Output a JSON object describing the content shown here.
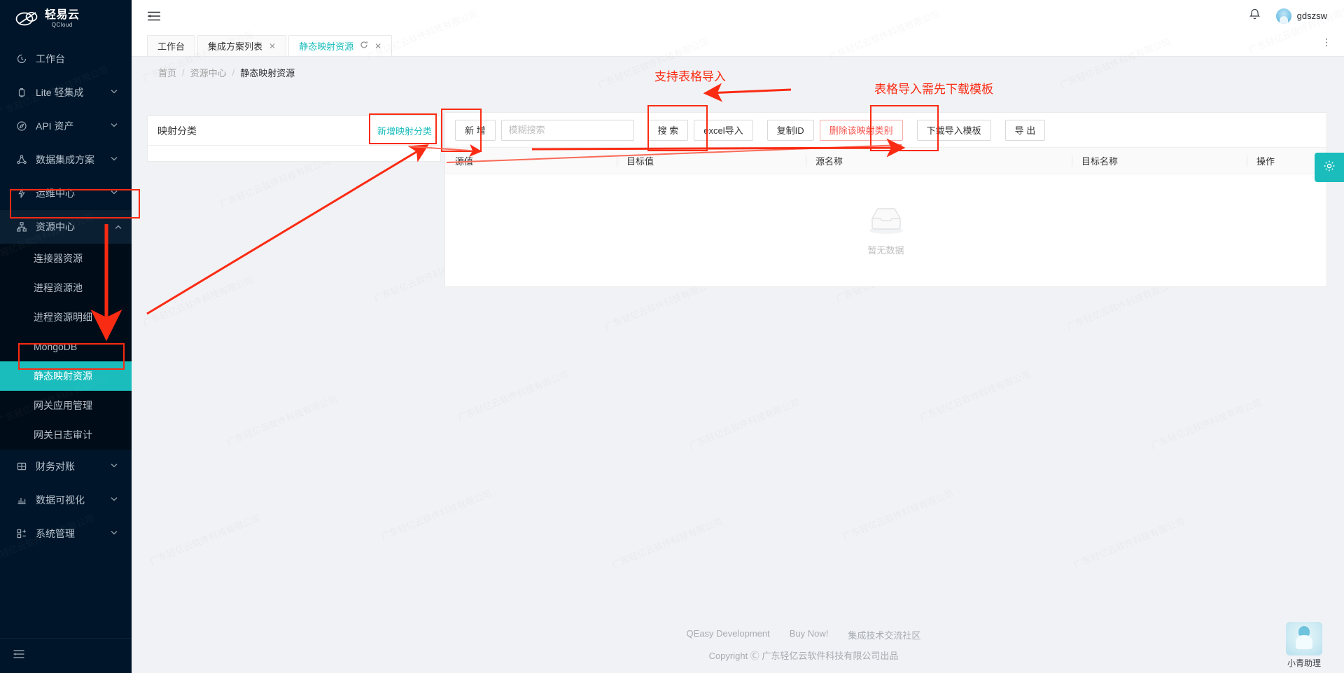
{
  "brand": {
    "name_cn": "轻易云",
    "name_en": "QCloud",
    "logo_icon": "cloud-logo-icon"
  },
  "sidebar": {
    "collapse_icon": "menu-collapse-icon",
    "items": [
      {
        "label": "工作台",
        "icon": "dashboard-icon",
        "expandable": false
      },
      {
        "label": "Lite 轻集成",
        "icon": "lite-integration-icon",
        "expandable": true
      },
      {
        "label": "API 资产",
        "icon": "api-asset-icon",
        "expandable": true
      },
      {
        "label": "数据集成方案",
        "icon": "data-integration-icon",
        "expandable": true
      },
      {
        "label": "运维中心",
        "icon": "ops-center-icon",
        "expandable": true
      },
      {
        "label": "资源中心",
        "icon": "resource-center-icon",
        "expandable": true,
        "expanded": true,
        "active": true
      },
      {
        "label": "财务对账",
        "icon": "finance-icon",
        "expandable": true
      },
      {
        "label": "数据可视化",
        "icon": "visualization-icon",
        "expandable": true
      },
      {
        "label": "系统管理",
        "icon": "system-settings-icon",
        "expandable": true
      }
    ],
    "submenu": [
      {
        "label": "连接器资源",
        "selected": false
      },
      {
        "label": "进程资源池",
        "selected": false
      },
      {
        "label": "进程资源明细",
        "selected": false
      },
      {
        "label": "MongoDB",
        "selected": false
      },
      {
        "label": "静态映射资源",
        "selected": true
      },
      {
        "label": "网关应用管理",
        "selected": false
      },
      {
        "label": "网关日志审计",
        "selected": false
      }
    ]
  },
  "topbar": {
    "collapse_icon": "sidebar-collapse-icon",
    "bell_icon": "notification-bell-icon",
    "username": "gdszsw",
    "avatar_icon": "user-avatar"
  },
  "tabs": {
    "items": [
      {
        "label": "工作台",
        "closable": false,
        "reloadable": false,
        "active": false
      },
      {
        "label": "集成方案列表",
        "closable": true,
        "reloadable": false,
        "active": false
      },
      {
        "label": "静态映射资源",
        "closable": true,
        "reloadable": true,
        "active": true
      }
    ],
    "more_icon": "tab-more-icon",
    "close_icon": "close-icon",
    "reload_icon": "reload-icon"
  },
  "breadcrumb": {
    "items": [
      "首页",
      "资源中心",
      "静态映射资源"
    ],
    "separator": "/"
  },
  "category_panel": {
    "title": "映射分类",
    "add_link": "新增映射分类"
  },
  "toolbar": {
    "add_label": "新 增",
    "search_placeholder": "模糊搜索",
    "search_value": "",
    "search_label": "搜 索",
    "excel_import_label": "excel导入",
    "copy_id_label": "复制ID",
    "delete_label": "删除该映射类别",
    "download_template_label": "下载导入模板",
    "export_label": "导 出"
  },
  "table": {
    "columns": [
      "源值",
      "目标值",
      "源名称",
      "目标名称",
      "操作"
    ],
    "rows": [],
    "empty_text": "暂无数据",
    "empty_icon": "empty-inbox-icon"
  },
  "side_settings": {
    "icon": "gear-icon"
  },
  "footer": {
    "links": [
      "QEasy Development",
      "Buy Now!",
      "集成技术交流社区"
    ],
    "copyright": "Copyright Ⓒ 广东轻亿云软件科技有限公司出品"
  },
  "assistant": {
    "label": "小青助理",
    "icon": "assistant-avatar-icon"
  },
  "watermark": {
    "text": "广东轻亿云软件科技有限公司"
  },
  "annotations": {
    "note_import": "支持表格导入",
    "note_template": "表格导入需先下载模板",
    "accent_color": "#fa2b13"
  },
  "colors": {
    "sidebar_bg": "#001529",
    "submenu_bg": "#000c17",
    "accent": "#1abcbc",
    "danger": "#f5524a",
    "page_bg": "#f0f2f5"
  }
}
